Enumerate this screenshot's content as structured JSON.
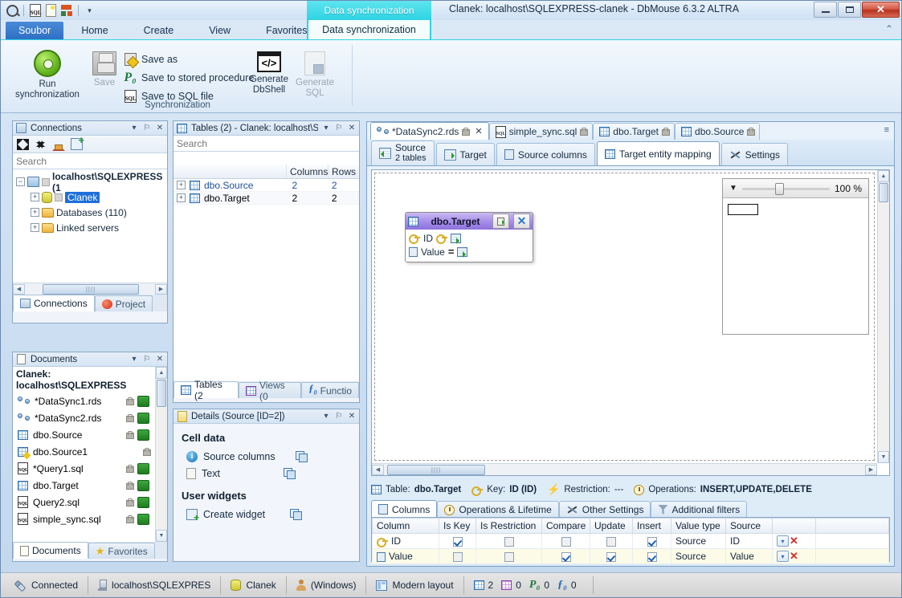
{
  "window": {
    "title": "Clanek: localhost\\SQLEXPRESS-clanek - DbMouse 6.3.2 ALTRA",
    "minimize": "–",
    "maximize": "□",
    "close": "✕"
  },
  "quick_access": {
    "icons": [
      "magnifier-icon",
      "sql-icon",
      "new-document-icon",
      "blocks-icon",
      "overflow-chevron-icon"
    ],
    "overflow": "▾"
  },
  "ribbon": {
    "file_tab": "Soubor",
    "tabs": [
      "Home",
      "Create",
      "View",
      "Favorites"
    ],
    "contextual_group": "Data synchronization",
    "contextual_tab": "Data synchronization",
    "collapse_icon": "⌃",
    "group_label": "Synchronization",
    "buttons": {
      "run_sync": "Run\nsynchronization",
      "run_sync_line1": "Run",
      "run_sync_line2": "synchronization",
      "save": "Save",
      "save_as": "Save as",
      "save_to_stored_procedure": "Save to stored procedure",
      "save_to_sql_file": "Save to SQL file",
      "generate_dbshell_line1": "Generate",
      "generate_dbshell_line2": "DbShell",
      "generate_sql_line1": "Generate",
      "generate_sql_line2": "SQL",
      "proc_glyph": "P₀",
      "sql_glyph": "SQL",
      "code_glyph": "</>"
    }
  },
  "connections_panel": {
    "title": "Connections",
    "menu_icon": "▾",
    "pin_icon": "⚐",
    "close_icon": "✕",
    "toolbar": [
      "expand-all-icon",
      "collapse-all-icon",
      "home-icon",
      "add-connection-icon"
    ],
    "search_placeholder": "Search",
    "tree": [
      {
        "label": "localhost\\SQLEXPRESS (1",
        "expander": "−",
        "level": 0,
        "icon": "server-icon",
        "bold": true
      },
      {
        "label": "Clanek",
        "expander": "+",
        "level": 1,
        "icon": "database-icon",
        "selected": true
      },
      {
        "label": "Databases (110)",
        "expander": "+",
        "level": 1,
        "icon": "folder-icon"
      },
      {
        "label": "Linked servers",
        "expander": "+",
        "level": 1,
        "icon": "folder-icon"
      }
    ],
    "tabs": [
      {
        "label": "Connections",
        "active": true,
        "icon": "connections-icon"
      },
      {
        "label": "Project",
        "active": false,
        "icon": "project-icon"
      }
    ]
  },
  "documents_panel": {
    "title": "Documents",
    "menu_icon": "▾",
    "pin_icon": "⚐",
    "close_icon": "✕",
    "group_label": "Clanek: localhost\\SQLEXPRESS",
    "items": [
      {
        "label": "*DataSync1.rds",
        "icon": "rds-icon",
        "locked": true,
        "sync": true
      },
      {
        "label": "*DataSync2.rds",
        "icon": "rds-icon",
        "locked": true,
        "sync": true
      },
      {
        "label": "dbo.Source",
        "icon": "table-icon",
        "locked": true,
        "sync": true
      },
      {
        "label": "dbo.Source1",
        "icon": "table-edit-icon",
        "locked": true,
        "sync": false
      },
      {
        "label": "*Query1.sql",
        "icon": "sql-icon",
        "locked": true,
        "sync": true
      },
      {
        "label": "dbo.Target",
        "icon": "table-icon",
        "locked": true,
        "sync": true
      },
      {
        "label": "Query2.sql",
        "icon": "sql-icon",
        "locked": true,
        "sync": true
      },
      {
        "label": "simple_sync.sql",
        "icon": "sql-icon",
        "locked": true,
        "sync": true
      }
    ],
    "tabs": [
      {
        "label": "Documents",
        "active": true,
        "icon": "documents-icon"
      },
      {
        "label": "Favorites",
        "active": false,
        "icon": "star-icon"
      }
    ]
  },
  "tables_panel": {
    "title": "Tables (2) - Clanek: localhost\\SC",
    "menu_icon": "▾",
    "pin_icon": "⚐",
    "close_icon": "✕",
    "search_placeholder": "Search",
    "columns": [
      "",
      "Columns",
      "Rows"
    ],
    "rows": [
      {
        "name": "dbo.Source",
        "columns": "2",
        "rows": "2",
        "expander": "+"
      },
      {
        "name": "dbo.Target",
        "columns": "2",
        "rows": "2",
        "expander": "+"
      }
    ],
    "tabs": [
      {
        "label": "Tables (2",
        "active": true,
        "icon": "table-icon"
      },
      {
        "label": "Views (0",
        "active": false,
        "icon": "view-icon"
      },
      {
        "label": "Functio",
        "active": false,
        "icon": "function-icon"
      }
    ]
  },
  "details_panel": {
    "title": "Details (Source [ID=2])",
    "menu_icon": "▾",
    "pin_icon": "⚐",
    "close_icon": "✕",
    "sections": [
      {
        "heading": "Cell data",
        "items": [
          {
            "label": "Source columns",
            "icon": "info-icon"
          },
          {
            "label": "Text",
            "icon": "text-icon"
          }
        ]
      },
      {
        "heading": "User widgets",
        "items": [
          {
            "label": "Create widget",
            "icon": "add-widget-icon"
          }
        ]
      }
    ]
  },
  "editor": {
    "document_tabs": [
      {
        "label": "*DataSync2.rds",
        "icon": "rds-icon",
        "locked": true,
        "active": true,
        "closable": true
      },
      {
        "label": "simple_sync.sql",
        "icon": "sql-icon",
        "locked": true,
        "active": false
      },
      {
        "label": "dbo.Target",
        "icon": "table-icon",
        "locked": true,
        "active": false
      },
      {
        "label": "dbo.Source",
        "icon": "table-icon",
        "locked": true,
        "active": false
      }
    ],
    "tab_overflow_icon": "≡",
    "close_icon": "✕",
    "sub_tabs": [
      {
        "label": "Source",
        "sub": "2 tables",
        "icon": "source-icon",
        "active": false
      },
      {
        "label": "Target",
        "icon": "target-icon",
        "active": false
      },
      {
        "label": "Source columns",
        "icon": "columns-icon",
        "active": false
      },
      {
        "label": "Target entity mapping",
        "icon": "mapping-icon",
        "active": true
      },
      {
        "label": "Settings",
        "icon": "settings-icon",
        "active": false
      }
    ],
    "entity": {
      "name": "dbo.Target",
      "icon": "table-icon",
      "export_button_icon": "export-icon",
      "close_button_icon": "✕",
      "fields": [
        {
          "name": "ID",
          "icon": "key-icon",
          "mapping_icon": "key-icon",
          "link_icon": "map-arrow-icon"
        },
        {
          "name": "Value",
          "icon": "column-icon",
          "operator": "=",
          "link_icon": "map-arrow-icon"
        }
      ]
    },
    "minimap": {
      "dropdown_icon": "▼",
      "zoom": "100 %"
    },
    "info_bar": {
      "table_label": "Table:",
      "table_value": "dbo.Target",
      "key_label": "Key:",
      "key_value": "ID (ID)",
      "restriction_label": "Restriction:",
      "restriction_value": "---",
      "operations_label": "Operations:",
      "operations_value": "INSERT,UPDATE,DELETE"
    },
    "grid_tabs": [
      {
        "label": "Columns",
        "icon": "columns-icon",
        "active": true
      },
      {
        "label": "Operations & Lifetime",
        "icon": "clock-icon",
        "active": false
      },
      {
        "label": "Other Settings",
        "icon": "settings-icon",
        "active": false
      },
      {
        "label": "Additional filters",
        "icon": "filter-icon",
        "active": false
      }
    ],
    "columns_grid": {
      "headers": [
        "Column",
        "Is Key",
        "Is Restriction",
        "Compare",
        "Update",
        "Insert",
        "Value type",
        "Source",
        ""
      ],
      "rows": [
        {
          "column": "ID",
          "icon": "key-icon",
          "is_key": true,
          "is_restriction": false,
          "compare": false,
          "update": false,
          "insert": true,
          "value_type": "Source",
          "source": "ID",
          "dropdown_icon": "▾",
          "delete_icon": "✕"
        },
        {
          "column": "Value",
          "icon": "column-icon",
          "is_key": false,
          "is_restriction": false,
          "compare": true,
          "update": true,
          "insert": true,
          "value_type": "Source",
          "source": "Value",
          "dropdown_icon": "▾",
          "delete_icon": "✕"
        }
      ]
    }
  },
  "statusbar": {
    "connection_status": "Connected",
    "server": "localhost\\SQLEXPRES",
    "database": "Clanek",
    "auth": "(Windows)",
    "layout": "Modern layout",
    "counts": {
      "tables": "2",
      "views": "0",
      "procedures": "0",
      "functions": "0",
      "proc_glyph": "P₀",
      "func_glyph": "ƒ₀"
    }
  },
  "colors": {
    "accent_cyan": "#2ed4e4",
    "file_tab_blue": "#2f6fc4",
    "selection_blue": "#1e6fd9",
    "entity_purple": "#a58ce8",
    "close_red": "#b8311d",
    "row_highlight": "#fcfbe8"
  }
}
